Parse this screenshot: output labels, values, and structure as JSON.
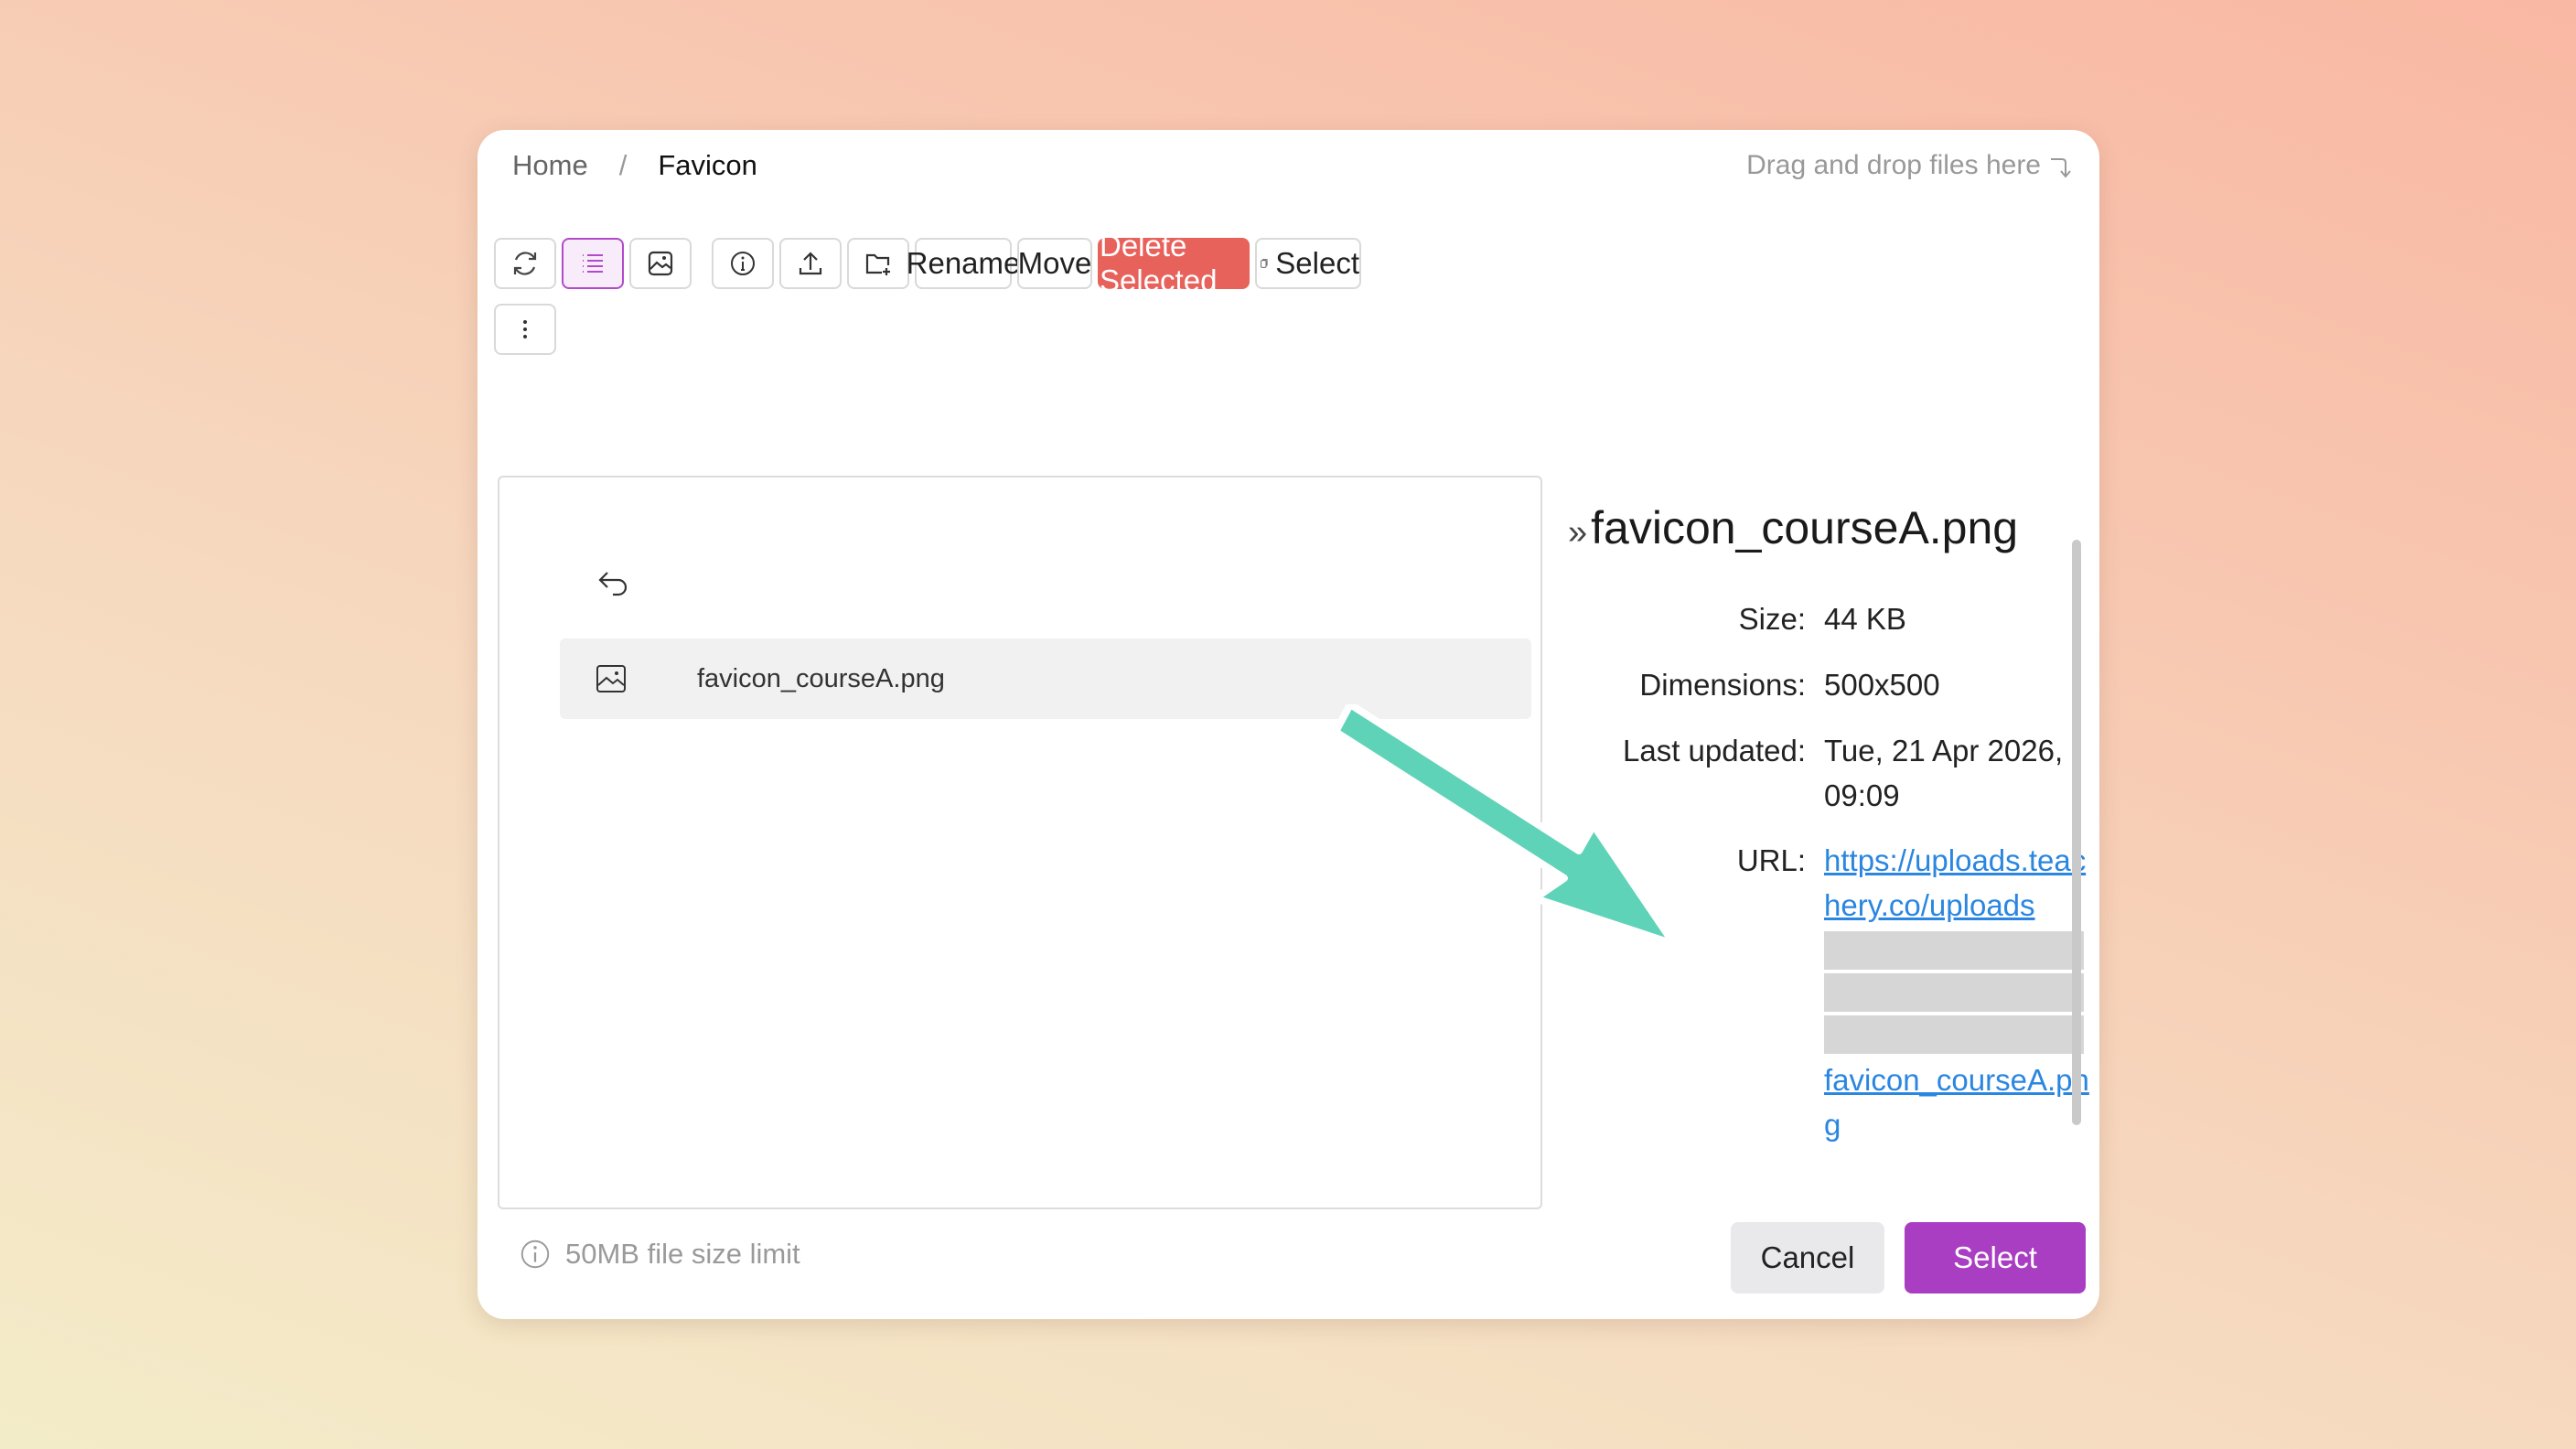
{
  "breadcrumb": {
    "home": "Home",
    "separator": "/",
    "current": "Favicon"
  },
  "drag_drop_hint": "Drag and drop files here",
  "toolbar": {
    "refresh_icon": "refresh-icon",
    "list_view_icon": "list-view-icon",
    "grid_view_icon": "image-grid-view-icon",
    "info_icon": "info-icon",
    "upload_icon": "upload-icon",
    "new_folder_icon": "new-folder-icon",
    "rename_label": "Rename",
    "move_label": "Move",
    "delete_label": "Delete Selected",
    "select_label": "Select",
    "more_icon": "more-vertical-icon"
  },
  "file_list": {
    "back_icon": "undo-back-icon",
    "items": [
      {
        "name": "favicon_courseA.png",
        "icon": "image-icon"
      }
    ]
  },
  "details": {
    "title": "favicon_courseA.png",
    "size_label": "Size:",
    "size_value": "44 KB",
    "dimensions_label": "Dimensions:",
    "dimensions_value": "500x500",
    "updated_label": "Last updated:",
    "updated_value": "Tue, 21 Apr 2026, 09:09",
    "url_label": "URL:",
    "url_start": "https://uploads.teachery.co/uploads",
    "url_end": "favicon_courseA.png"
  },
  "footer": {
    "limit_text": "50MB file size limit",
    "cancel_label": "Cancel",
    "select_label": "Select"
  },
  "colors": {
    "accent": "#a93ec2",
    "danger": "#e8625c",
    "link": "#2a86e0",
    "annotation_arrow": "#5fd3b8"
  }
}
